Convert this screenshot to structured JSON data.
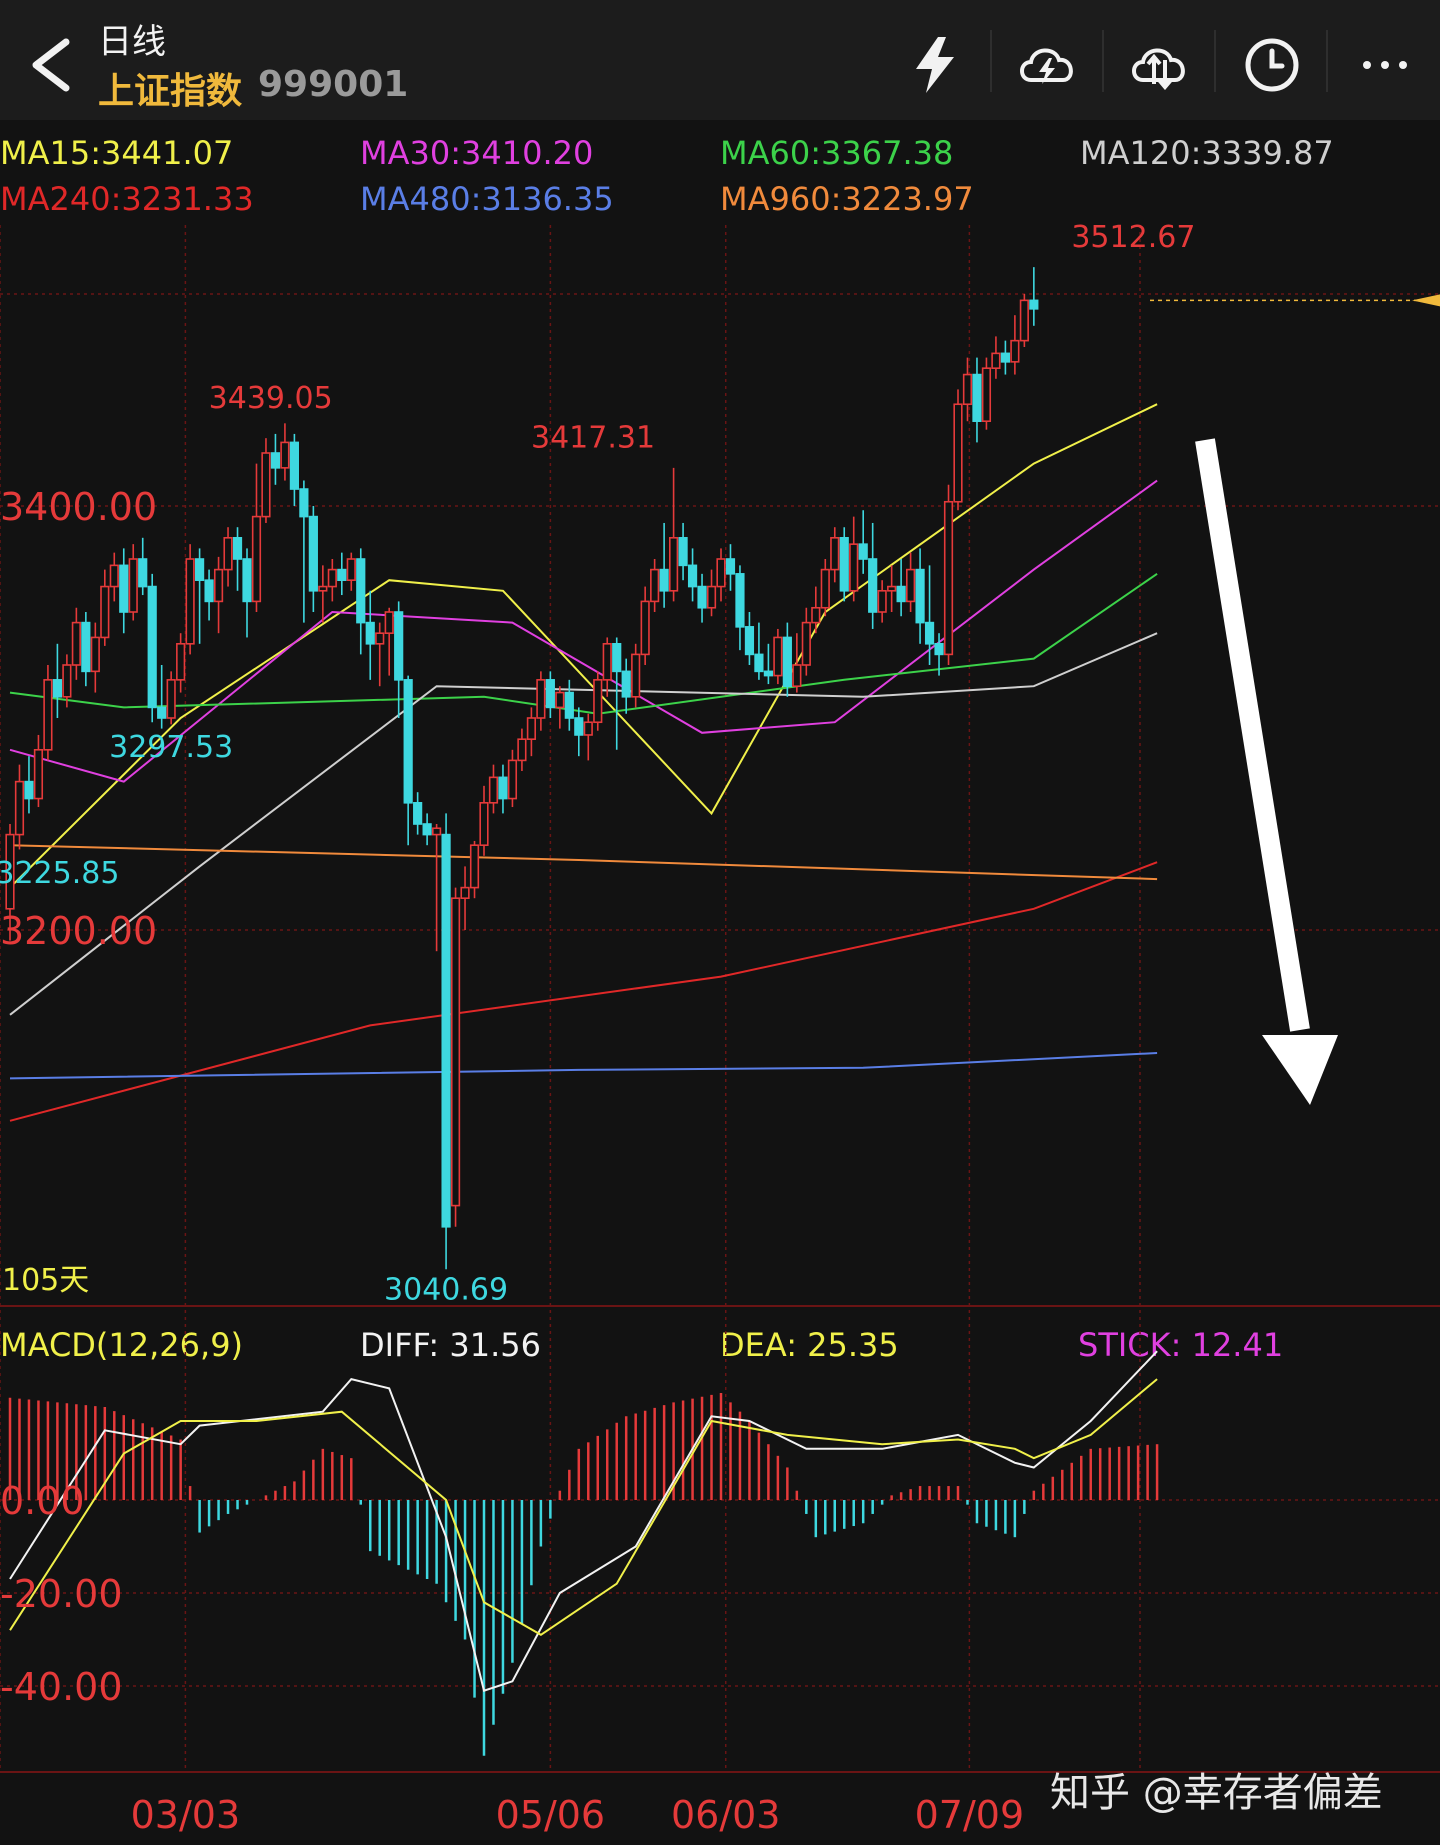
{
  "header": {
    "period": "日线",
    "index_name": "上证指数",
    "index_code": "999001",
    "icons": [
      "back-icon",
      "lightning-icon",
      "cloud-lightning-icon",
      "cloud-sync-icon",
      "clock-icon",
      "more-icon"
    ]
  },
  "ma_legend": [
    {
      "text": "MA15:3441.07",
      "color": "#f0f04a"
    },
    {
      "text": "MA30:3410.20",
      "color": "#e040e0"
    },
    {
      "text": "MA60:3367.38",
      "color": "#3cd24a"
    },
    {
      "text": "MA120:3339.87",
      "color": "#cfcfcf"
    },
    {
      "text": "MA240:3231.33",
      "color": "#e02828"
    },
    {
      "text": "MA480:3136.35",
      "color": "#5a7ee6"
    },
    {
      "text": "MA960:3223.97",
      "color": "#f08a3c"
    }
  ],
  "macd_legend": [
    {
      "text": "MACD(12,26,9)",
      "color": "#f0f04a"
    },
    {
      "text": "DIFF: 31.56",
      "color": "#f2f2f2"
    },
    {
      "text": "DEA: 25.35",
      "color": "#f0f04a"
    },
    {
      "text": "STICK: 12.41",
      "color": "#e040e0"
    }
  ],
  "colors": {
    "up": "#e53a3a",
    "down": "#3ed8e0",
    "grid": "#6a1414",
    "axis_label": "#e53a3a",
    "current_price_line": "#f0b93c"
  },
  "chart_data": [
    {
      "type": "candlestick",
      "title": "",
      "ylim": [
        3000,
        3540
      ],
      "y_ticks": [
        {
          "value": 3400,
          "label": "3400.00"
        },
        {
          "value": 3200,
          "label": "3200.00"
        }
      ],
      "x_ticks": [
        "03/03",
        "05/06",
        "06/03",
        "07/09"
      ],
      "annotations": [
        {
          "text": "3512.67",
          "value": 3512.67,
          "kind": "high"
        },
        {
          "text": "3439.05",
          "value": 3439.05,
          "kind": "high"
        },
        {
          "text": "3417.31",
          "value": 3417.31,
          "kind": "high"
        },
        {
          "text": "3297.53",
          "value": 3297.53,
          "kind": "low"
        },
        {
          "text": "3225.85",
          "value": 3225.85,
          "kind": "low"
        },
        {
          "text": "3040.69",
          "value": 3040.69,
          "kind": "low"
        }
      ],
      "period_label": "105天",
      "current_price": 3497,
      "candles": [
        [
          3210,
          3245,
          3195,
          3250
        ],
        [
          3245,
          3270,
          3238,
          3278
        ],
        [
          3270,
          3262,
          3255,
          3282
        ],
        [
          3262,
          3285,
          3258,
          3292
        ],
        [
          3285,
          3318,
          3280,
          3325
        ],
        [
          3318,
          3310,
          3300,
          3335
        ],
        [
          3310,
          3325,
          3305,
          3330
        ],
        [
          3325,
          3345,
          3318,
          3352
        ],
        [
          3345,
          3322,
          3315,
          3350
        ],
        [
          3322,
          3338,
          3312,
          3345
        ],
        [
          3338,
          3362,
          3334,
          3370
        ],
        [
          3362,
          3372,
          3355,
          3378
        ],
        [
          3372,
          3350,
          3340,
          3380
        ],
        [
          3350,
          3375,
          3346,
          3382
        ],
        [
          3375,
          3362,
          3358,
          3385
        ],
        [
          3362,
          3305,
          3298,
          3368
        ],
        [
          3305,
          3300,
          3295,
          3325
        ],
        [
          3300,
          3318,
          3297,
          3322
        ],
        [
          3318,
          3335,
          3312,
          3340
        ],
        [
          3335,
          3375,
          3330,
          3382
        ],
        [
          3375,
          3365,
          3335,
          3380
        ],
        [
          3365,
          3355,
          3346,
          3370
        ],
        [
          3355,
          3370,
          3340,
          3376
        ],
        [
          3370,
          3385,
          3362,
          3390
        ],
        [
          3385,
          3375,
          3360,
          3390
        ],
        [
          3375,
          3355,
          3338,
          3380
        ],
        [
          3355,
          3395,
          3350,
          3420
        ],
        [
          3395,
          3425,
          3392,
          3432
        ],
        [
          3425,
          3418,
          3410,
          3434
        ],
        [
          3418,
          3430,
          3412,
          3439
        ],
        [
          3430,
          3408,
          3400,
          3434
        ],
        [
          3408,
          3395,
          3345,
          3412
        ],
        [
          3395,
          3360,
          3350,
          3400
        ],
        [
          3360,
          3362,
          3345,
          3372
        ],
        [
          3362,
          3370,
          3355,
          3375
        ],
        [
          3370,
          3365,
          3358,
          3378
        ],
        [
          3365,
          3375,
          3360,
          3378
        ],
        [
          3375,
          3345,
          3330,
          3380
        ],
        [
          3345,
          3335,
          3318,
          3360
        ],
        [
          3335,
          3340,
          3315,
          3345
        ],
        [
          3340,
          3350,
          3320,
          3352
        ],
        [
          3350,
          3318,
          3300,
          3355
        ],
        [
          3318,
          3260,
          3240,
          3320
        ],
        [
          3260,
          3250,
          3245,
          3265
        ],
        [
          3250,
          3245,
          3240,
          3255
        ],
        [
          3245,
          3248,
          3190,
          3250
        ],
        [
          3245,
          3060,
          3040,
          3255
        ],
        [
          3070,
          3215,
          3060,
          3220
        ],
        [
          3215,
          3220,
          3200,
          3230
        ],
        [
          3220,
          3240,
          3215,
          3242
        ],
        [
          3240,
          3260,
          3235,
          3268
        ],
        [
          3260,
          3272,
          3255,
          3278
        ],
        [
          3272,
          3262,
          3255,
          3278
        ],
        [
          3262,
          3280,
          3258,
          3285
        ],
        [
          3280,
          3290,
          3275,
          3295
        ],
        [
          3290,
          3300,
          3282,
          3305
        ],
        [
          3300,
          3318,
          3294,
          3322
        ],
        [
          3318,
          3305,
          3300,
          3322
        ],
        [
          3305,
          3312,
          3295,
          3315
        ],
        [
          3312,
          3300,
          3294,
          3318
        ],
        [
          3300,
          3292,
          3282,
          3305
        ],
        [
          3292,
          3298,
          3280,
          3302
        ],
        [
          3298,
          3318,
          3294,
          3322
        ],
        [
          3318,
          3335,
          3310,
          3338
        ],
        [
          3335,
          3322,
          3285,
          3338
        ],
        [
          3322,
          3310,
          3302,
          3328
        ],
        [
          3310,
          3330,
          3305,
          3335
        ],
        [
          3330,
          3355,
          3325,
          3362
        ],
        [
          3355,
          3370,
          3350,
          3375
        ],
        [
          3370,
          3360,
          3352,
          3392
        ],
        [
          3360,
          3385,
          3355,
          3418
        ],
        [
          3385,
          3372,
          3365,
          3392
        ],
        [
          3372,
          3362,
          3355,
          3380
        ],
        [
          3362,
          3352,
          3345,
          3368
        ],
        [
          3352,
          3362,
          3348,
          3370
        ],
        [
          3362,
          3375,
          3355,
          3380
        ],
        [
          3375,
          3368,
          3360,
          3382
        ],
        [
          3368,
          3343,
          3332,
          3372
        ],
        [
          3343,
          3330,
          3325,
          3350
        ],
        [
          3330,
          3322,
          3318,
          3345
        ],
        [
          3322,
          3320,
          3316,
          3335
        ],
        [
          3320,
          3338,
          3316,
          3342
        ],
        [
          3338,
          3315,
          3310,
          3345
        ],
        [
          3315,
          3325,
          3312,
          3340
        ],
        [
          3325,
          3345,
          3320,
          3352
        ],
        [
          3345,
          3352,
          3340,
          3362
        ],
        [
          3352,
          3370,
          3348,
          3375
        ],
        [
          3370,
          3385,
          3364,
          3390
        ],
        [
          3385,
          3360,
          3355,
          3390
        ],
        [
          3360,
          3382,
          3355,
          3395
        ],
        [
          3382,
          3375,
          3368,
          3398
        ],
        [
          3375,
          3350,
          3342,
          3392
        ],
        [
          3350,
          3360,
          3345,
          3365
        ],
        [
          3360,
          3362,
          3350,
          3372
        ],
        [
          3362,
          3355,
          3348,
          3375
        ],
        [
          3355,
          3370,
          3350,
          3378
        ],
        [
          3370,
          3345,
          3335,
          3380
        ],
        [
          3345,
          3335,
          3325,
          3372
        ],
        [
          3335,
          3330,
          3320,
          3340
        ],
        [
          3330,
          3402,
          3325,
          3410
        ],
        [
          3402,
          3448,
          3398,
          3455
        ],
        [
          3448,
          3462,
          3440,
          3470
        ],
        [
          3462,
          3440,
          3430,
          3470
        ],
        [
          3440,
          3465,
          3436,
          3470
        ],
        [
          3465,
          3472,
          3460,
          3480
        ],
        [
          3472,
          3468,
          3462,
          3478
        ],
        [
          3468,
          3478,
          3462,
          3490
        ],
        [
          3478,
          3497,
          3475,
          3500
        ],
        [
          3497,
          3493,
          3485,
          3512.67
        ]
      ],
      "series": [
        {
          "name": "MA15",
          "color": "#f0f04a",
          "values": [
            [
              0,
              3220
            ],
            [
              18,
              3300
            ],
            [
              40,
              3365
            ],
            [
              52,
              3360
            ],
            [
              74,
              3255
            ],
            [
              86,
              3350
            ],
            [
              108,
              3420
            ],
            [
              121,
              3448
            ]
          ]
        },
        {
          "name": "MA30",
          "color": "#e040e0",
          "values": [
            [
              0,
              3285
            ],
            [
              12,
              3270
            ],
            [
              34,
              3350
            ],
            [
              53,
              3345
            ],
            [
              73,
              3293
            ],
            [
              87,
              3298
            ],
            [
              108,
              3370
            ],
            [
              121,
              3412
            ]
          ]
        },
        {
          "name": "MA60",
          "color": "#3cd24a",
          "values": [
            [
              0,
              3312
            ],
            [
              12,
              3305
            ],
            [
              50,
              3310
            ],
            [
              62,
              3302
            ],
            [
              88,
              3318
            ],
            [
              108,
              3328
            ],
            [
              121,
              3368
            ]
          ]
        },
        {
          "name": "MA120",
          "color": "#cfcfcf",
          "values": [
            [
              0,
              3160
            ],
            [
              20,
              3230
            ],
            [
              45,
              3315
            ],
            [
              90,
              3310
            ],
            [
              108,
              3315
            ],
            [
              121,
              3340
            ]
          ]
        },
        {
          "name": "MA240",
          "color": "#e02828",
          "values": [
            [
              0,
              3110
            ],
            [
              38,
              3155
            ],
            [
              75,
              3178
            ],
            [
              108,
              3210
            ],
            [
              121,
              3232
            ]
          ]
        },
        {
          "name": "MA480",
          "color": "#5a7ee6",
          "values": [
            [
              0,
              3130
            ],
            [
              60,
              3134
            ],
            [
              90,
              3135
            ],
            [
              121,
              3142
            ]
          ]
        },
        {
          "name": "MA960",
          "color": "#f08a3c",
          "values": [
            [
              0,
              3240
            ],
            [
              60,
              3233
            ],
            [
              121,
              3224
            ]
          ]
        }
      ]
    },
    {
      "type": "bar",
      "title": "",
      "ylim": [
        -58,
        30
      ],
      "y_ticks": [
        {
          "value": 0,
          "label": "0.00"
        },
        {
          "value": -20,
          "label": "-20.00"
        },
        {
          "value": -40,
          "label": "-40.00"
        }
      ],
      "histogram": [
        [
          0,
          22
        ],
        [
          10,
          20
        ],
        [
          18,
          13
        ],
        [
          20,
          -7
        ],
        [
          23,
          -3
        ],
        [
          28,
          2
        ],
        [
          30,
          4
        ],
        [
          33,
          11
        ],
        [
          36,
          9
        ],
        [
          38,
          -11
        ],
        [
          45,
          -18
        ],
        [
          48,
          -30
        ],
        [
          50,
          -55
        ],
        [
          53,
          -35
        ],
        [
          56,
          -10
        ],
        [
          58,
          2
        ],
        [
          60,
          11
        ],
        [
          65,
          18
        ],
        [
          70,
          21
        ],
        [
          75,
          23
        ],
        [
          78,
          17
        ],
        [
          82,
          7
        ],
        [
          85,
          -8
        ],
        [
          90,
          -5
        ],
        [
          93,
          1
        ],
        [
          96,
          3
        ],
        [
          100,
          3
        ],
        [
          102,
          -5
        ],
        [
          106,
          -8
        ],
        [
          108,
          2
        ],
        [
          114,
          11
        ],
        [
          121,
          12
        ]
      ],
      "series": [
        {
          "name": "DIFF",
          "color": "#f2f2f2",
          "values": [
            [
              0,
              -17
            ],
            [
              10,
              15
            ],
            [
              18,
              12
            ],
            [
              20,
              16
            ],
            [
              33,
              19
            ],
            [
              36,
              26
            ],
            [
              40,
              24
            ],
            [
              46,
              -8
            ],
            [
              50,
              -41
            ],
            [
              53,
              -39
            ],
            [
              58,
              -20
            ],
            [
              66,
              -10
            ],
            [
              74,
              18
            ],
            [
              78,
              17
            ],
            [
              84,
              11
            ],
            [
              92,
              11
            ],
            [
              100,
              14
            ],
            [
              106,
              8
            ],
            [
              108,
              7
            ],
            [
              114,
              17
            ],
            [
              121,
              32
            ]
          ]
        },
        {
          "name": "DEA",
          "color": "#f0f04a",
          "values": [
            [
              0,
              -28
            ],
            [
              12,
              10
            ],
            [
              18,
              17
            ],
            [
              26,
              17
            ],
            [
              35,
              19
            ],
            [
              46,
              0
            ],
            [
              50,
              -22
            ],
            [
              56,
              -29
            ],
            [
              64,
              -18
            ],
            [
              74,
              17
            ],
            [
              82,
              14
            ],
            [
              92,
              12
            ],
            [
              100,
              13
            ],
            [
              106,
              11
            ],
            [
              108,
              9
            ],
            [
              114,
              14
            ],
            [
              121,
              26
            ]
          ]
        }
      ]
    }
  ],
  "watermark": "知乎 @幸存者偏差"
}
